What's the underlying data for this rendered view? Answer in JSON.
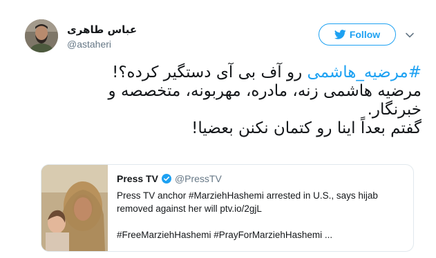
{
  "author": {
    "name": "عباس طاهری",
    "handle": "@astaheri",
    "avatar_icon": "avatar-photo"
  },
  "follow": {
    "label": "Follow",
    "icon": "twitter-bird-icon"
  },
  "menu": {
    "icon": "chevron-down-icon"
  },
  "tweet": {
    "hashtag": "#مرضیه_هاشمی",
    "line1_rest": " رو آف بی آی دستگیر کرده؟!",
    "line2": "مرضیه هاشمی زنه، مادره، مهربونه، متخصصه و",
    "line3": "خبرنگار.",
    "line4": "گفتم بعداً اینا رو کتمان نکنن بعضیا!"
  },
  "quoted": {
    "name": "Press TV",
    "handle": "@PressTV",
    "verified_icon": "verified-badge-icon",
    "text": "Press TV anchor #MarziehHashemi arrested in U.S., says hijab\nremoved against her will ptv.io/2gjL\n\n#FreeMarziehHashemi #PrayForMarziehHashemi ...",
    "media_icon": "photo-thumbnail"
  },
  "colors": {
    "accent": "#1da1f2",
    "text": "#14171a",
    "secondary": "#657786",
    "border": "#e1e8ed"
  }
}
